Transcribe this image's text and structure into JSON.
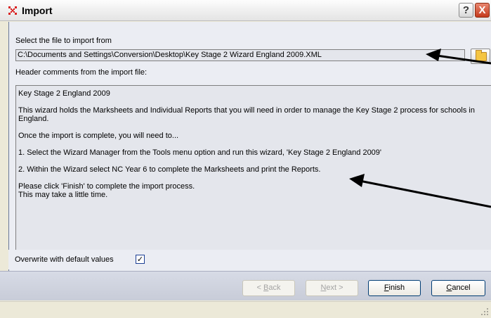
{
  "window": {
    "title": "Import",
    "help_label": "?",
    "close_label": "X"
  },
  "file": {
    "label": "Select the file to import from",
    "path": "C:\\Documents and Settings\\Conversion\\Desktop\\Key Stage 2 Wizard England 2009.XML"
  },
  "comments": {
    "label": "Header comments from the import file:",
    "paragraphs": [
      "Key Stage 2 England 2009",
      "This wizard holds the Marksheets and Individual Reports that you will need in order to manage the Key Stage 2 process for schools in England.",
      "Once the import is complete, you will need to...",
      "1.  Select the Wizard Manager from the Tools menu option and run this wizard, 'Key Stage 2 England 2009'",
      "2.  Within the Wizard select NC Year 6 to complete the Marksheets and print the Reports.",
      "Please click 'Finish' to complete the import process.",
      "This may take a little time."
    ]
  },
  "overwrite": {
    "label": "Overwrite with default values",
    "checked": true,
    "check_glyph": "✓"
  },
  "buttons": {
    "back": {
      "first": "B",
      "rest": "ack",
      "prefix": "< ",
      "enabled": false
    },
    "next": {
      "first": "N",
      "rest": "ext >",
      "enabled": false
    },
    "finish": {
      "first": "F",
      "rest": "inish",
      "enabled": true
    },
    "cancel": {
      "first": "C",
      "rest": "ancel",
      "enabled": true
    }
  },
  "icons": {
    "app": "red-cross-app-icon",
    "browse": "folder-icon",
    "grip": "resize-grip-icon"
  },
  "colors": {
    "close_button": "#c43a1c",
    "panel": "#ebedf3",
    "field": "#e4e6ec",
    "button_border": "#003c74",
    "checkbox_border": "#1c3f94"
  }
}
